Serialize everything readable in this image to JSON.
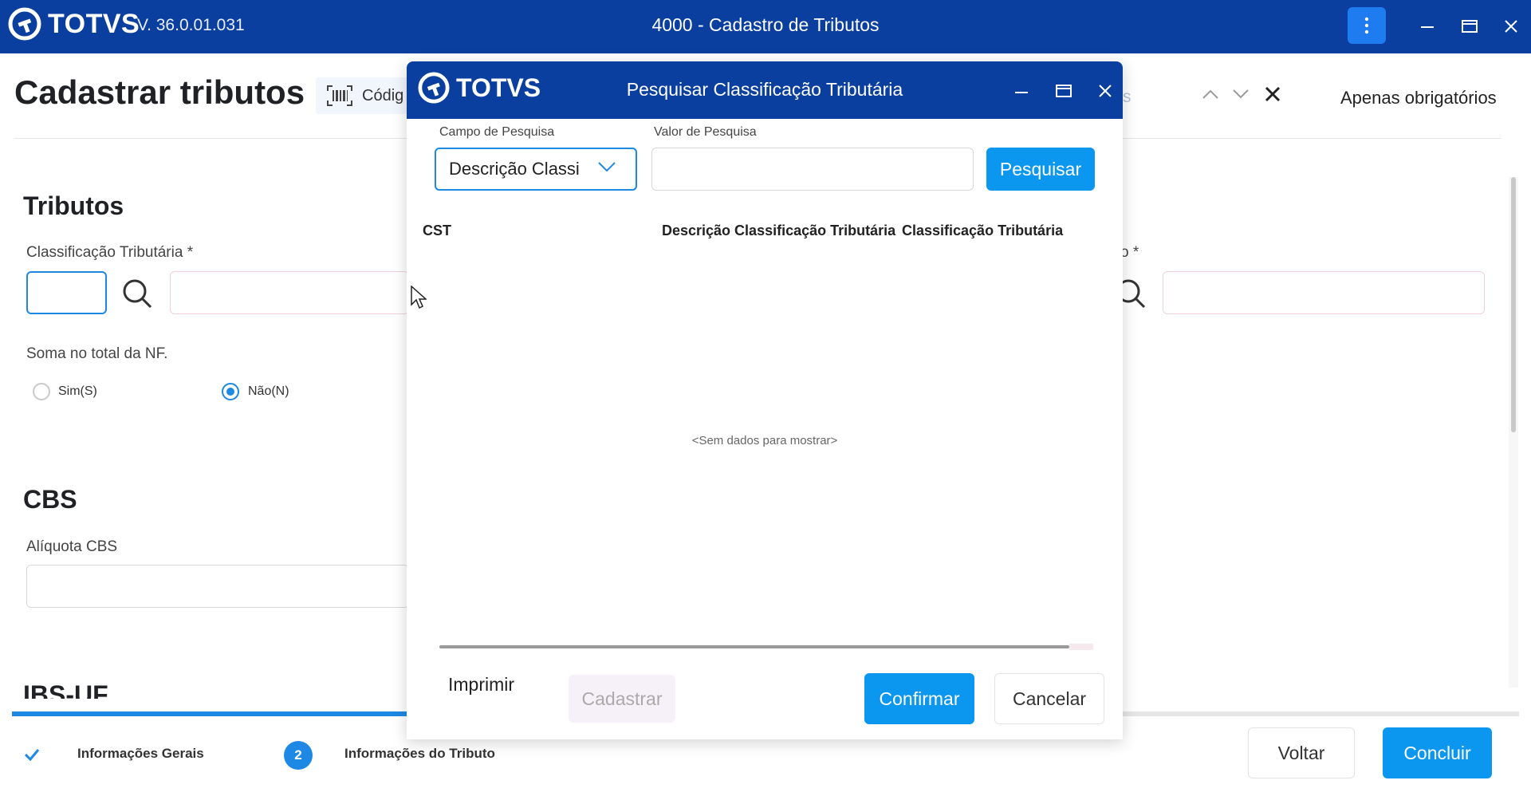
{
  "app": {
    "logo_text": "TOTVS",
    "version": "V. 36.0.01.031",
    "title": "4000 - Cadastro de Tributos"
  },
  "page": {
    "title": "Cadastrar tributos",
    "barcode_label": "Códig",
    "faded_letter": "s",
    "required_only": "Apenas obrigatórios"
  },
  "tributos": {
    "title": "Tributos",
    "class_label": "Classificação Tributária *",
    "right_label_fragment": "o *",
    "sum_label": "Soma no total da NF.",
    "sum_options": [
      {
        "label": "Sim(S)",
        "selected": false
      },
      {
        "label": "Não(N)",
        "selected": true
      }
    ]
  },
  "cbs": {
    "title": "CBS",
    "aliquota_label": "Alíquota CBS"
  },
  "ibs": {
    "title_partial": "IBS-UF"
  },
  "wizard": {
    "progress_fraction": 0.26,
    "steps": [
      {
        "label": "Informações Gerais",
        "state": "done"
      },
      {
        "number": "2",
        "label": "Informações do Tributo",
        "state": "current"
      }
    ],
    "back_label": "Voltar",
    "finish_label": "Concluir"
  },
  "modal": {
    "logo_text": "TOTVS",
    "title": "Pesquisar Classificação Tributária",
    "search_field_label": "Campo de Pesquisa",
    "search_field_value": "Descrição Classi",
    "search_value_label": "Valor de Pesquisa",
    "search_value": "",
    "search_button": "Pesquisar",
    "columns": [
      "CST",
      "Descrição Classificação Tributária",
      "Classificação Tributária"
    ],
    "empty_message": "<Sem dados para mostrar>",
    "print_label": "Imprimir",
    "create_label": "Cadastrar",
    "confirm_label": "Confirmar",
    "cancel_label": "Cancelar"
  },
  "colors": {
    "brand_blue": "#0a3fa0",
    "primary_button": "#0b96f0",
    "accent": "#1e88e5"
  },
  "icons": [
    "totvs-logo-icon",
    "kebab-menu-icon",
    "minimize-icon",
    "maximize-icon",
    "close-icon",
    "barcode-icon",
    "chevron-up-icon",
    "chevron-down-icon",
    "search-icon",
    "check-icon",
    "mouse-cursor-icon"
  ]
}
